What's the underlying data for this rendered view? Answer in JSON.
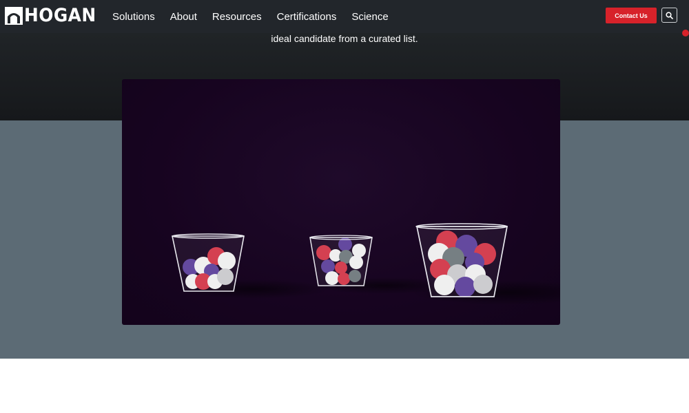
{
  "brand": {
    "name": "HOGAN",
    "logo_icon": "hogan-arch-logo-icon"
  },
  "nav": {
    "items": [
      {
        "label": "Solutions"
      },
      {
        "label": "About"
      },
      {
        "label": "Resources"
      },
      {
        "label": "Certifications"
      },
      {
        "label": "Science"
      }
    ]
  },
  "header": {
    "contact_label": "Contact Us",
    "search_icon": "search-icon"
  },
  "hero": {
    "text": "ideal candidate from a curated list."
  },
  "video": {
    "description_icon": "jars-of-balls-animation",
    "colors": {
      "background": "#170420",
      "red": "#d23547",
      "purple": "#5b3e9a",
      "white": "#efefef",
      "gray": "#8b8f94",
      "slate": "#6e787c"
    }
  },
  "colors": {
    "header_bg": "#22262b",
    "accent_red": "#d7222a",
    "slate_band": "#5c6b75"
  }
}
